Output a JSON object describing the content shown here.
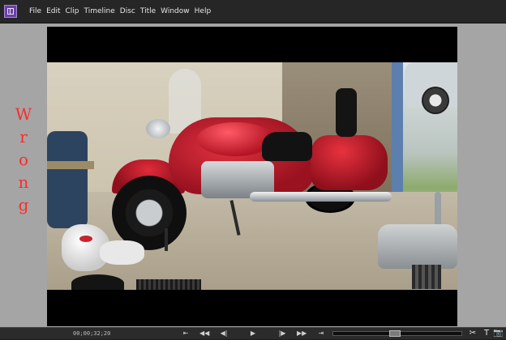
{
  "menu": {
    "items": [
      "File",
      "Edit",
      "Clip",
      "Timeline",
      "Disc",
      "Title",
      "Window",
      "Help"
    ]
  },
  "app": {
    "logo_icon": "app-logo-icon"
  },
  "annotation": {
    "text": "Wrong",
    "color": "#ff2a2a"
  },
  "transport": {
    "timecode": "00;00;32;20",
    "buttons": [
      {
        "name": "go-to-in-icon",
        "glyph": "⇤"
      },
      {
        "name": "step-back-icon",
        "glyph": "◀◀"
      },
      {
        "name": "frame-back-icon",
        "glyph": "◀|"
      },
      {
        "name": "play-icon",
        "glyph": "▶"
      },
      {
        "name": "frame-forward-icon",
        "glyph": "|▶"
      },
      {
        "name": "step-forward-icon",
        "glyph": "▶▶"
      },
      {
        "name": "go-to-out-icon",
        "glyph": "⇥"
      }
    ],
    "playhead_fraction": 0.48,
    "tools": [
      {
        "name": "scissors-icon",
        "glyph": "✂"
      },
      {
        "name": "title-tool-icon",
        "glyph": "T"
      },
      {
        "name": "camera-icon",
        "glyph": "📷"
      }
    ]
  }
}
